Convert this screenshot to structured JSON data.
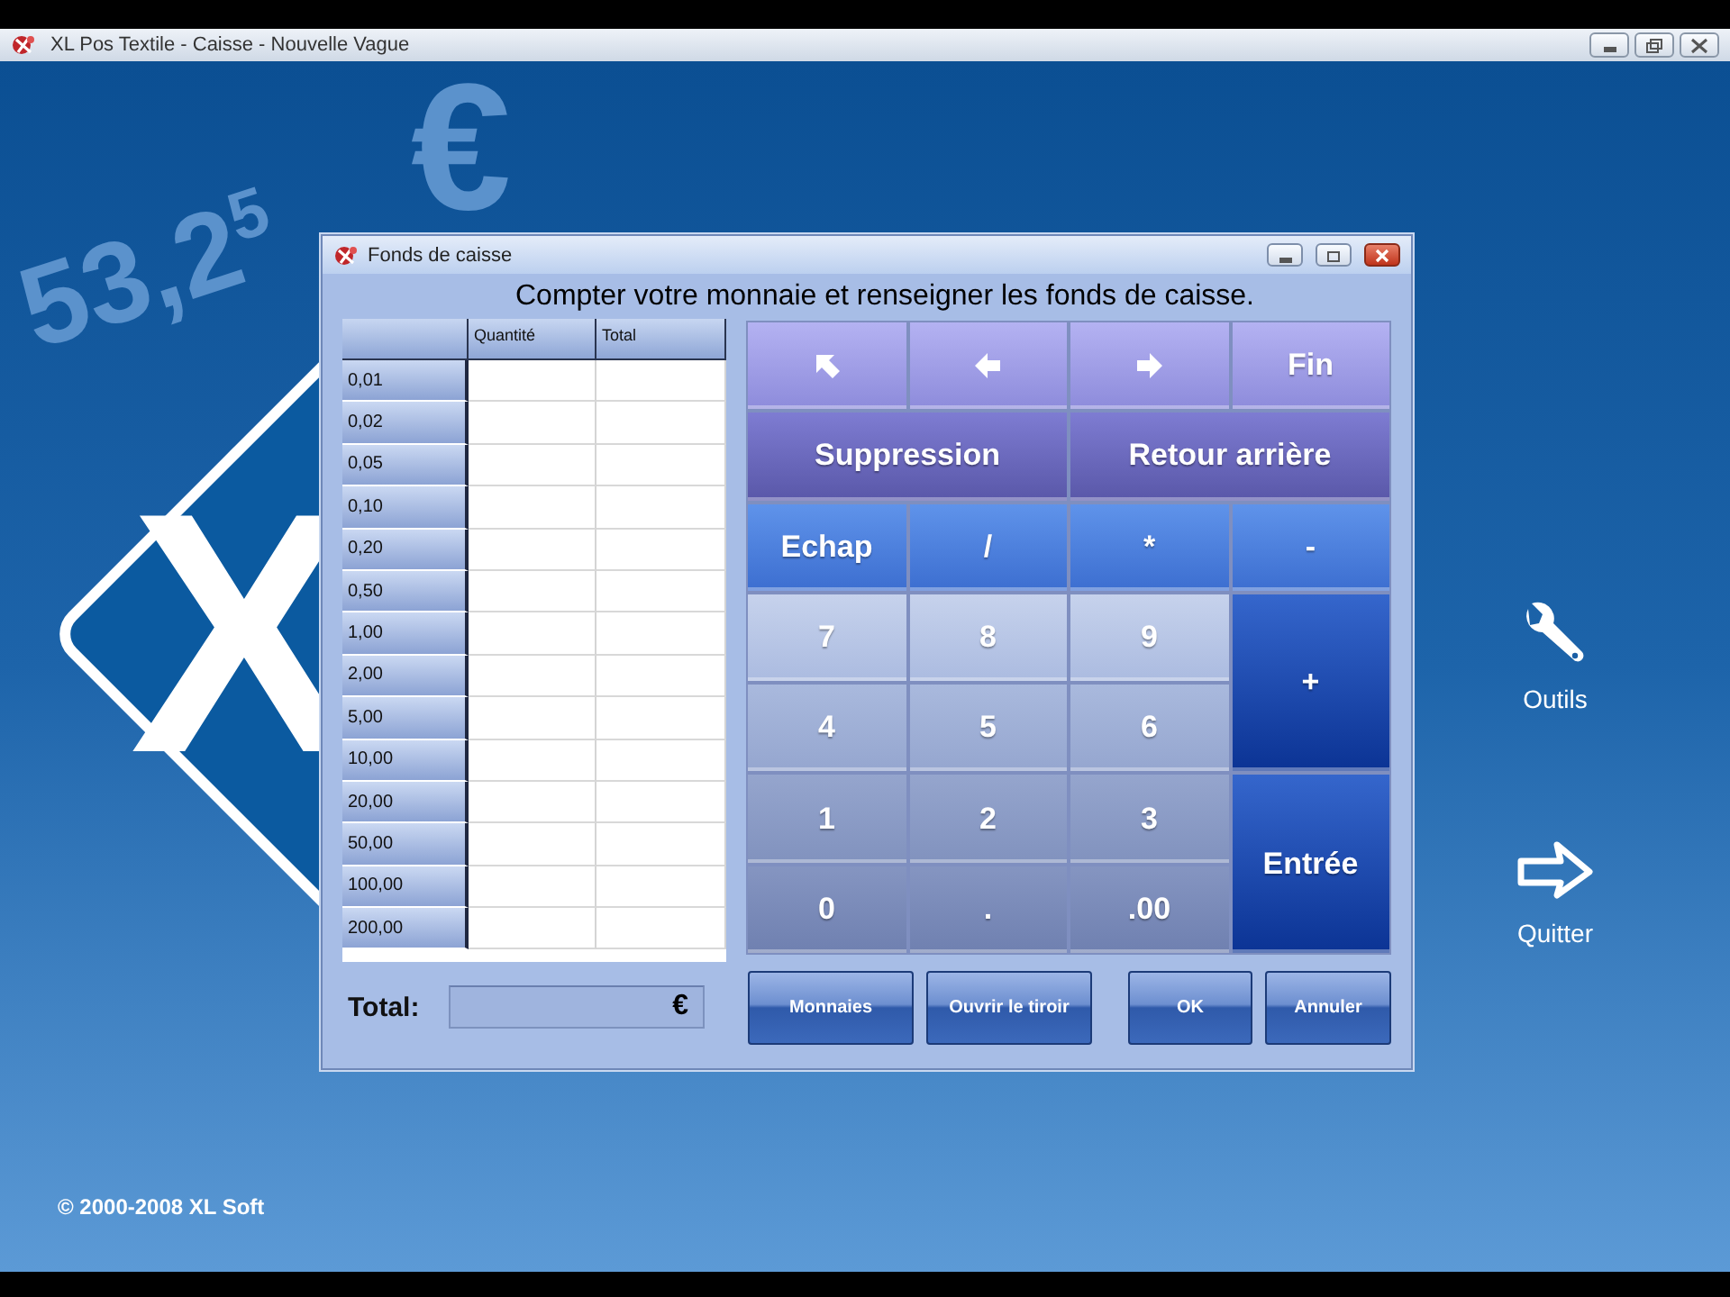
{
  "window": {
    "title": "XL Pos Textile - Caisse - Nouvelle Vague"
  },
  "backdrop": {
    "figures": "53,2$^{5}$",
    "currency": "€",
    "logo": "X"
  },
  "dialog": {
    "title": "Fonds de caisse",
    "instruction": "Compter votre monnaie et renseigner les fonds de caisse.",
    "table": {
      "columns": [
        "Quantité",
        "Total"
      ],
      "rows": [
        {
          "denomination": "0,01"
        },
        {
          "denomination": "0,02"
        },
        {
          "denomination": "0,05"
        },
        {
          "denomination": "0,10"
        },
        {
          "denomination": "0,20"
        },
        {
          "denomination": "0,50"
        },
        {
          "denomination": "1,00"
        },
        {
          "denomination": "2,00"
        },
        {
          "denomination": "5,00"
        },
        {
          "denomination": "10,00"
        },
        {
          "denomination": "20,00"
        },
        {
          "denomination": "50,00"
        },
        {
          "denomination": "100,00"
        },
        {
          "denomination": "200,00"
        }
      ]
    },
    "keypad": [
      {
        "kind": "icon"
      },
      {
        "kind": "icon"
      },
      {
        "kind": "icon"
      },
      {
        "kind": "text",
        "label": "Fin"
      },
      {
        "kind": "text",
        "label": "Suppression"
      },
      {
        "kind": "text",
        "label": "Retour arrière"
      },
      {
        "kind": "text",
        "label": "Echap"
      },
      {
        "kind": "text",
        "label": "/"
      },
      {
        "kind": "text",
        "label": "*"
      },
      {
        "kind": "text",
        "label": "-"
      },
      {
        "kind": "text",
        "label": "7"
      },
      {
        "kind": "text",
        "label": "8"
      },
      {
        "kind": "text",
        "label": "9"
      },
      {
        "kind": "text",
        "label": "+"
      },
      {
        "kind": "text",
        "label": "4"
      },
      {
        "kind": "text",
        "label": "5"
      },
      {
        "kind": "text",
        "label": "6"
      },
      {
        "kind": "text",
        "label": "1"
      },
      {
        "kind": "text",
        "label": "2"
      },
      {
        "kind": "text",
        "label": "3"
      },
      {
        "kind": "text",
        "label": "Entrée"
      },
      {
        "kind": "text",
        "label": "0"
      },
      {
        "kind": "text",
        "label": "."
      },
      {
        "kind": "text",
        "label": ".00"
      }
    ],
    "total": {
      "label": "Total:",
      "currency": "€"
    },
    "buttons": [
      "Monnaies",
      "Ouvrir le tiroir",
      "OK",
      "Annuler"
    ]
  },
  "side_actions": [
    {
      "label": "Outils"
    },
    {
      "label": "Quitter"
    }
  ],
  "copyright": "© 2000-2008 XL Soft"
}
